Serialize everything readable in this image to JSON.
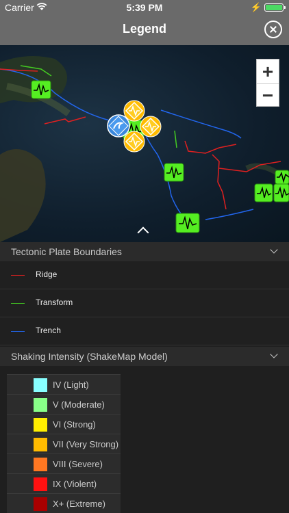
{
  "status_bar": {
    "carrier": "Carrier",
    "time": "5:39 PM"
  },
  "header": {
    "title": "Legend"
  },
  "zoom": {
    "in_label": "+",
    "out_label": "−"
  },
  "tectonic": {
    "title": "Tectonic Plate Boundaries",
    "items": [
      {
        "label": "Ridge",
        "color": "#e02020"
      },
      {
        "label": "Transform",
        "color": "#44cc22"
      },
      {
        "label": "Trench",
        "color": "#2266ee"
      }
    ]
  },
  "shaking": {
    "title": "Shaking Intensity (ShakeMap Model)",
    "items": [
      {
        "label": "IV (Light)",
        "color": "#88ffff"
      },
      {
        "label": "V (Moderate)",
        "color": "#88ff88"
      },
      {
        "label": "VI (Strong)",
        "color": "#ffee00"
      },
      {
        "label": "VII (Very Strong)",
        "color": "#ffbb00"
      },
      {
        "label": "VIII (Severe)",
        "color": "#ff7722"
      },
      {
        "label": "IX (Violent)",
        "color": "#ff1111"
      },
      {
        "label": "X+ (Extreme)",
        "color": "#aa0000"
      }
    ]
  },
  "icons": {
    "wifi": "wifi-icon",
    "battery": "battery-icon",
    "close": "close-icon",
    "seismo": "seismograph-icon",
    "shake": "shake-intensity-icon",
    "tsunami": "tsunami-icon"
  }
}
